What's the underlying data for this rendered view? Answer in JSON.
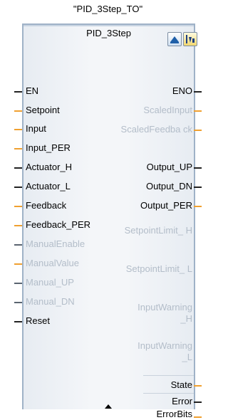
{
  "instance_name": "\"PID_3Step_TO\"",
  "block": {
    "title": "PID_3Step",
    "icons": [
      "parameter-assignment-icon",
      "commissioning-icon"
    ]
  },
  "inputs": [
    {
      "label": "EN",
      "pin": "black",
      "enabled": true
    },
    {
      "label": "Setpoint",
      "pin": "orange",
      "enabled": true
    },
    {
      "label": "Input",
      "pin": "orange",
      "enabled": true
    },
    {
      "label": "Input_PER",
      "pin": "orange",
      "enabled": true
    },
    {
      "label": "Actuator_H",
      "pin": "black",
      "enabled": true
    },
    {
      "label": "Actuator_L",
      "pin": "black",
      "enabled": true
    },
    {
      "label": "Feedback",
      "pin": "orange",
      "enabled": true
    },
    {
      "label": "Feedback_PER",
      "pin": "orange",
      "enabled": true
    },
    {
      "label": "ManualEnable",
      "pin": "grey",
      "enabled": false
    },
    {
      "label": "ManualValue",
      "pin": "orange",
      "enabled": false
    },
    {
      "label": "Manual_UP",
      "pin": "grey",
      "enabled": false
    },
    {
      "label": "Manual_DN",
      "pin": "grey",
      "enabled": false
    },
    {
      "label": "Reset",
      "pin": "black",
      "enabled": true
    }
  ],
  "outputs": [
    {
      "label": "ENO",
      "pin": "black",
      "enabled": true
    },
    {
      "label": "ScaledInput",
      "pin": "orange",
      "enabled": false
    },
    {
      "label": "ScaledFeedba ck",
      "pin": "orange",
      "enabled": false
    },
    {
      "label": "Output_UP",
      "pin": "black",
      "enabled": true
    },
    {
      "label": "Output_DN",
      "pin": "black",
      "enabled": true
    },
    {
      "label": "Output_PER",
      "pin": "orange",
      "enabled": true
    },
    {
      "label": "SetpointLimit_ H",
      "pin": "none",
      "enabled": false
    },
    {
      "label": "SetpointLimit_ L",
      "pin": "none",
      "enabled": false
    },
    {
      "label": "InputWarning _H",
      "pin": "none",
      "enabled": false
    },
    {
      "label": "InputWarning _L",
      "pin": "none",
      "enabled": false
    },
    {
      "label": "State",
      "pin": "orange",
      "enabled": true
    },
    {
      "label": "Error",
      "pin": "black",
      "enabled": true
    },
    {
      "label": "ErrorBits",
      "pin": "orange",
      "enabled": true
    }
  ],
  "colors": {
    "block_border": "#9fb2c7",
    "pin_orange": "#f0a030",
    "pin_black": "#222222",
    "disabled_text": "#b3bdc9"
  }
}
